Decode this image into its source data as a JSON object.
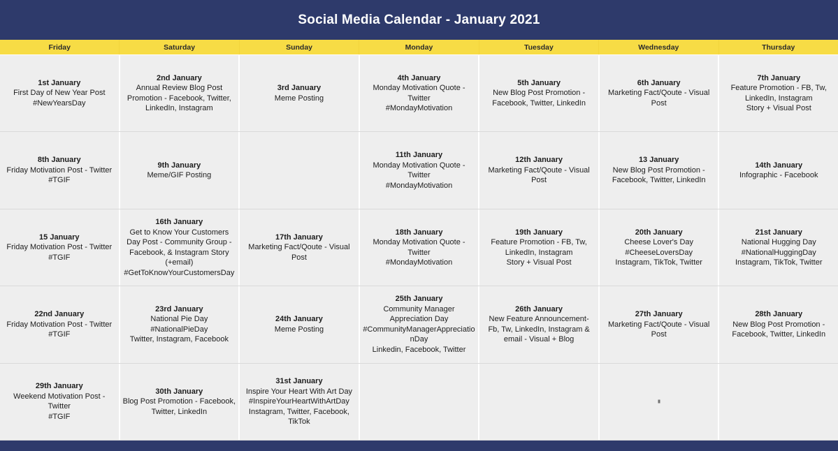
{
  "header": {
    "title": "Social Media Calendar - January 2021",
    "accent_navy": "#2e3a6b",
    "accent_yellow": "#f7dc45",
    "cell_bg": "#eeeeee"
  },
  "weekdays": [
    {
      "label": "Friday"
    },
    {
      "label": "Saturday"
    },
    {
      "label": "Sunday"
    },
    {
      "label": "Monday"
    },
    {
      "label": "Tuesday"
    },
    {
      "label": "Wednesday"
    },
    {
      "label": "Thursday"
    }
  ],
  "weeks": [
    [
      {
        "date": "1st January",
        "lines": [
          "First Day of New Year Post",
          "#NewYearsDay"
        ]
      },
      {
        "date": "2nd January",
        "lines": [
          "Annual Review Blog Post Promotion - Facebook, Twitter, LinkedIn, Instagram"
        ]
      },
      {
        "date": "3rd January",
        "lines": [
          "Meme Posting"
        ]
      },
      {
        "date": "4th January",
        "lines": [
          "Monday Motivation Quote - Twitter",
          "#MondayMotivation"
        ]
      },
      {
        "date": "5th January",
        "lines": [
          "New Blog Post Promotion - Facebook, Twitter, LinkedIn"
        ]
      },
      {
        "date": "6th January",
        "lines": [
          "Marketing Fact/Qoute - Visual Post"
        ]
      },
      {
        "date": "7th January",
        "lines": [
          "Feature Promotion - FB, Tw, LinkedIn, Instagram",
          "Story + Visual Post"
        ]
      }
    ],
    [
      {
        "date": "8th January",
        "lines": [
          "Friday Motivation Post - Twitter",
          "#TGIF"
        ]
      },
      {
        "date": "9th January",
        "lines": [
          "Meme/GIF Posting"
        ]
      },
      {
        "date": "",
        "lines": []
      },
      {
        "date": "11th January",
        "lines": [
          "Monday Motivation Quote - Twitter",
          "#MondayMotivation"
        ]
      },
      {
        "date": "12th January",
        "lines": [
          "Marketing Fact/Qoute - Visual Post"
        ]
      },
      {
        "date": "13 January",
        "lines": [
          "New Blog Post Promotion - Facebook, Twitter, LinkedIn"
        ]
      },
      {
        "date": "14th January",
        "lines": [
          "Infographic - Facebook"
        ]
      }
    ],
    [
      {
        "date": "15 January",
        "lines": [
          "Friday Motivation Post - Twitter",
          "#TGIF"
        ]
      },
      {
        "date": "16th January",
        "lines": [
          "Get to Know Your Customers Day Post - Community Group - Facebook, & Instagram Story (+email)",
          "#GetToKnowYourCustomersDay"
        ]
      },
      {
        "date": "17th January",
        "lines": [
          "Marketing Fact/Qoute - Visual Post"
        ]
      },
      {
        "date": "18th January",
        "lines": [
          "Monday Motivation Quote - Twitter",
          "#MondayMotivation"
        ]
      },
      {
        "date": "19th January",
        "lines": [
          "Feature Promotion - FB, Tw, LinkedIn, Instagram",
          "Story + Visual Post"
        ]
      },
      {
        "date": "20th January",
        "lines": [
          "Cheese Lover's Day",
          "#CheeseLoversDay",
          "Instagram, TikTok, Twitter"
        ]
      },
      {
        "date": "21st January",
        "lines": [
          "National Hugging Day",
          "#NationalHuggingDay",
          "Instagram, TikTok, Twitter"
        ]
      }
    ],
    [
      {
        "date": "22nd January",
        "lines": [
          "Friday Motivation Post - Twitter",
          "#TGIF"
        ]
      },
      {
        "date": "23rd January",
        "lines": [
          "National Pie Day",
          "#NationalPieDay",
          "Twitter, Instagram, Facebook"
        ]
      },
      {
        "date": "24th January",
        "lines": [
          "Meme Posting"
        ]
      },
      {
        "date": "25th January",
        "lines": [
          "Community Manager Appreciation Day",
          "#CommunityManagerAppreciationDay",
          "Linkedin, Facebook, Twitter"
        ]
      },
      {
        "date": "26th January",
        "lines": [
          "New Feature Announcement- Fb, Tw, LinkedIn, Instagram & email - Visual + Blog"
        ]
      },
      {
        "date": "27th January",
        "lines": [
          "Marketing Fact/Qoute - Visual Post"
        ]
      },
      {
        "date": "28th January",
        "lines": [
          "New Blog Post Promotion - Facebook, Twitter, LinkedIn"
        ]
      }
    ],
    [
      {
        "date": "29th January",
        "lines": [
          "Weekend Motivation Post - Twitter",
          "#TGIF"
        ]
      },
      {
        "date": "30th January",
        "lines": [
          "Blog Post Promotion - Facebook, Twitter, LinkedIn"
        ]
      },
      {
        "date": "31st January",
        "lines": [
          "Inspire Your Heart With Art Day",
          "#InspireYourHeartWithArtDay",
          "Instagram, Twitter, Facebook, TikTok"
        ]
      },
      {
        "date": "",
        "lines": []
      },
      {
        "date": "",
        "lines": []
      },
      {
        "date": "",
        "lines": []
      },
      {
        "date": "",
        "lines": []
      }
    ]
  ]
}
